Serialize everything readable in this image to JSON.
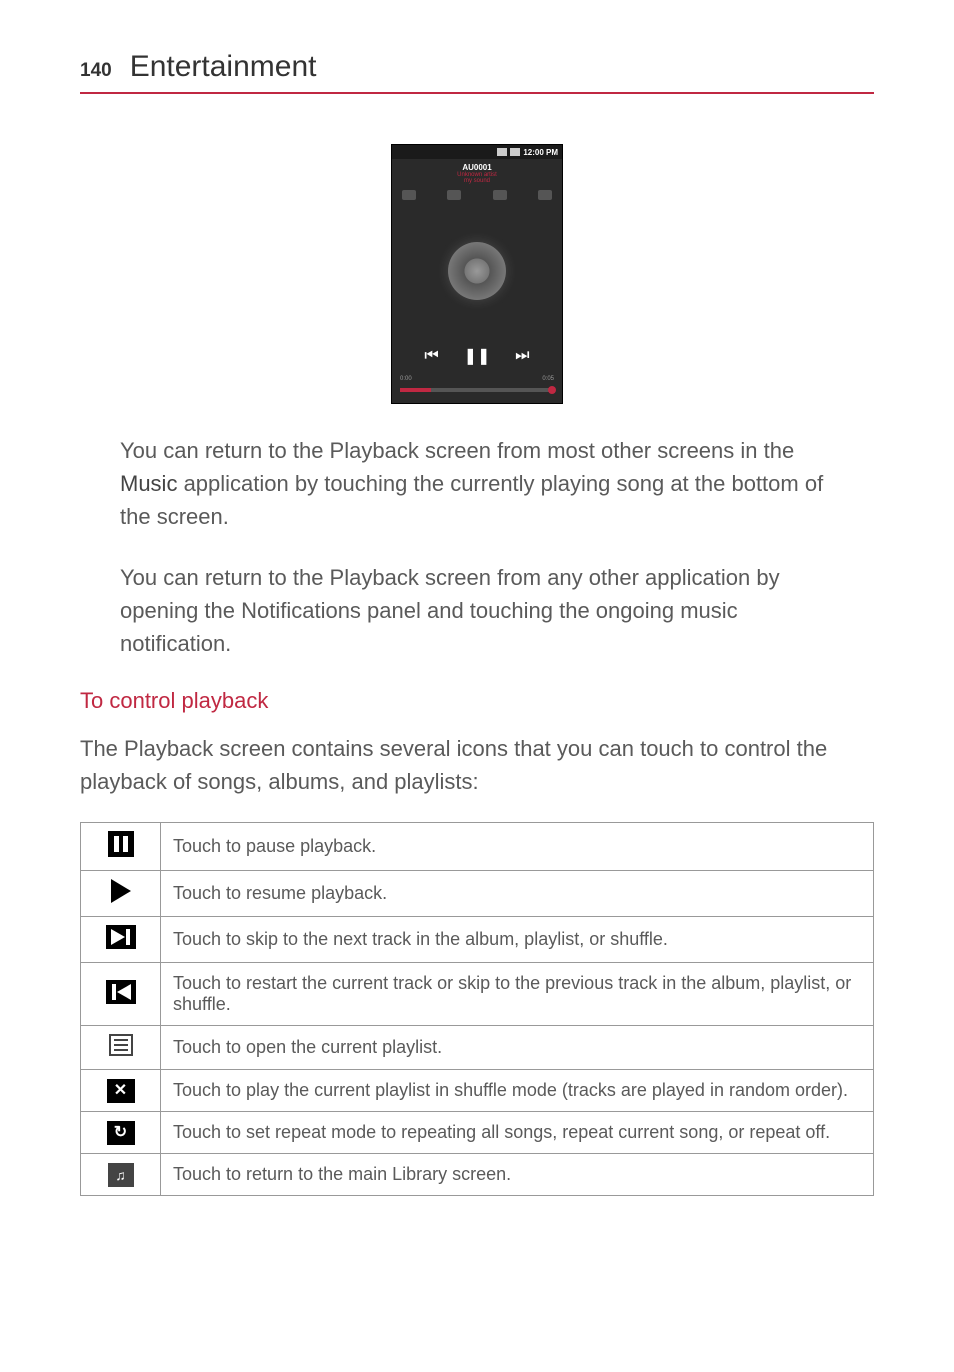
{
  "header": {
    "page_number": "140",
    "section": "Entertainment"
  },
  "phone": {
    "time": "12:00 PM",
    "track_title": "AU0001",
    "track_sub1": "Unknown artist",
    "track_sub2": "my sound",
    "time_left": "0:00",
    "time_right": "0:05"
  },
  "paragraphs": {
    "p1_pre": "You can return to the Playback screen from most other screens in the ",
    "p1_emph": "Music",
    "p1_post": " application by touching the currently playing song at the bottom of the screen.",
    "p2": "You can return to the Playback screen from any other application by opening the Notifications panel and touching the ongoing music notification."
  },
  "subheading": "To control playback",
  "intro": "The Playback screen contains several icons that you can touch to control the playback of songs, albums, and playlists:",
  "table": [
    {
      "icon": "pause",
      "desc": "Touch to pause playback."
    },
    {
      "icon": "play",
      "desc": "Touch to resume playback."
    },
    {
      "icon": "next",
      "desc": "Touch to skip to the next track in the album, playlist, or shuffle."
    },
    {
      "icon": "prev",
      "desc": "Touch to restart the current track or skip to the previous track in the album, playlist, or shuffle."
    },
    {
      "icon": "list",
      "desc": "Touch to open the current playlist."
    },
    {
      "icon": "shuffle",
      "desc": "Touch to play the current playlist in shuffle mode (tracks are played in random order)."
    },
    {
      "icon": "repeat",
      "desc": "Touch to set repeat mode to repeating all songs, repeat current song, or repeat off."
    },
    {
      "icon": "library",
      "desc": "Touch to return to the main Library screen."
    }
  ]
}
